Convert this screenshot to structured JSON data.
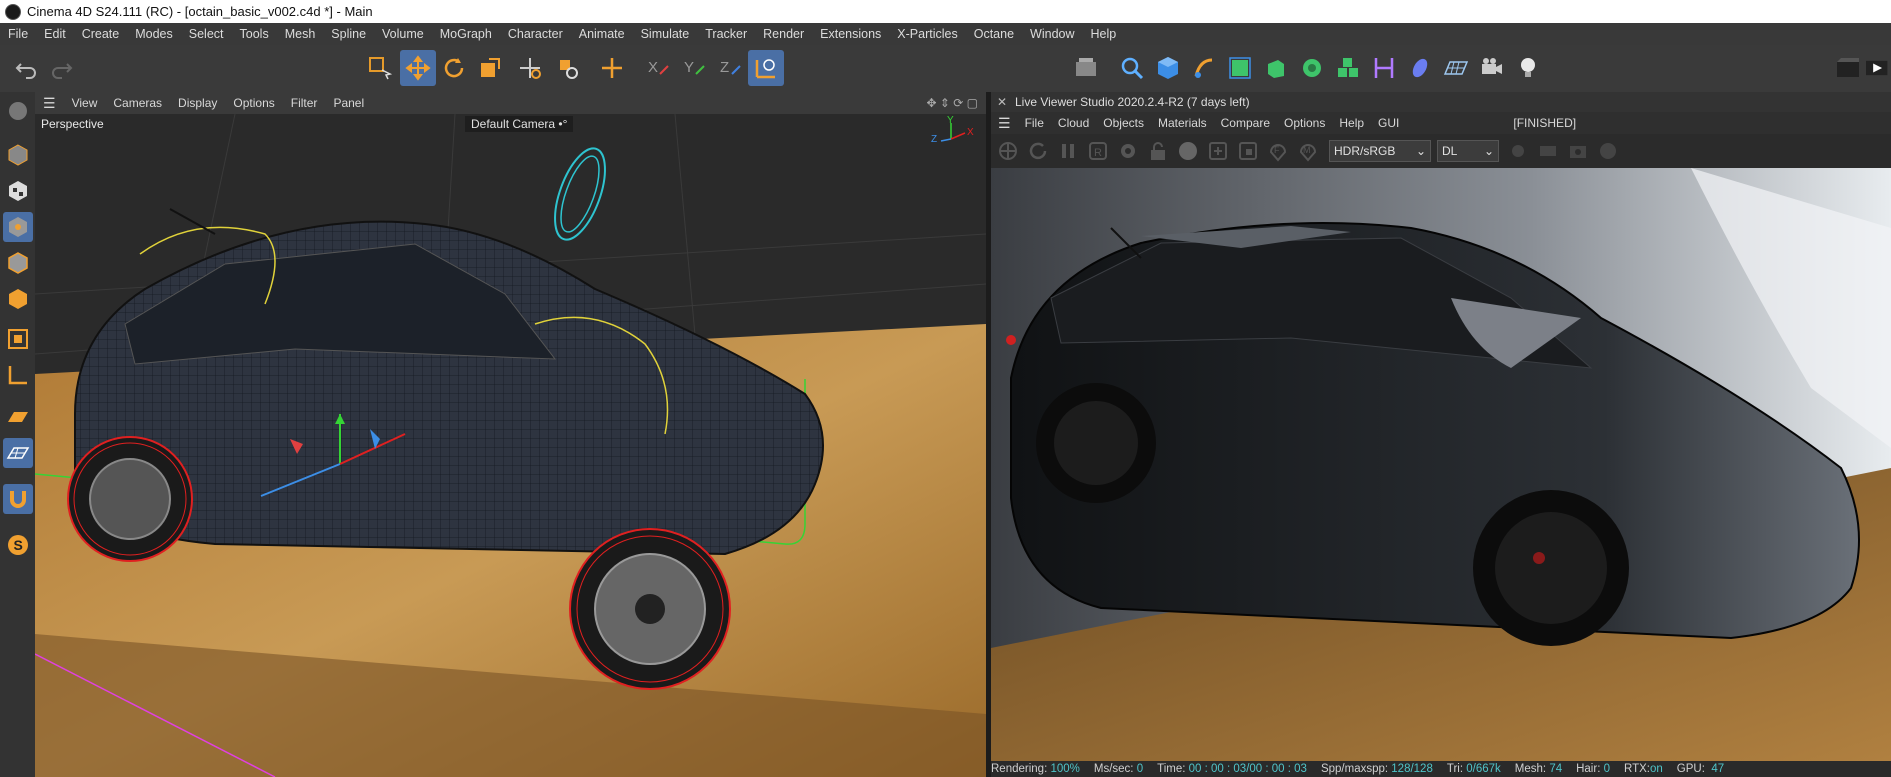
{
  "window": {
    "title": "Cinema 4D S24.111 (RC) - [octain_basic_v002.c4d *] - Main"
  },
  "menu": [
    "File",
    "Edit",
    "Create",
    "Modes",
    "Select",
    "Tools",
    "Mesh",
    "Spline",
    "Volume",
    "MoGraph",
    "Character",
    "Animate",
    "Simulate",
    "Tracker",
    "Render",
    "Extensions",
    "X-Particles",
    "Octane",
    "Window",
    "Help"
  ],
  "toolbar_icons": [
    "undo-icon",
    "redo-icon",
    "live-selection-icon",
    "move-icon",
    "rotate-icon",
    "scale-icon",
    "transform-icon",
    "place-icon",
    "axis-icon",
    "lock-x-icon",
    "lock-y-icon",
    "lock-z-icon",
    "coordinate-system-icon",
    "render-region-icon",
    "spline-pen-icon",
    "cube-icon",
    "paint-icon",
    "subdivision-icon",
    "extrude-icon",
    "mograph-icon",
    "cloner-icon",
    "symmetry-icon",
    "field-icon",
    "floor-icon",
    "camera-icon",
    "light-icon",
    "render-settings-icon"
  ],
  "viewport": {
    "menu": [
      "View",
      "Cameras",
      "Display",
      "Options",
      "Filter",
      "Panel"
    ],
    "label": "Perspective",
    "camera": "Default Camera",
    "camera_suffix": "•°",
    "axis": {
      "x": "X",
      "y": "Y",
      "z": "Z"
    }
  },
  "live_viewer": {
    "title": "Live Viewer Studio 2020.2.4-R2 (7 days left)",
    "menu": [
      "File",
      "Cloud",
      "Objects",
      "Materials",
      "Compare",
      "Options",
      "Help",
      "GUI"
    ],
    "status": "[FINISHED]",
    "color_space": "HDR/sRGB",
    "kernel": "DL"
  },
  "status": {
    "rendering_label": "Rendering:",
    "rendering": "100%",
    "ms_label": "Ms/sec:",
    "ms": "0",
    "time_label": "Time:",
    "time": "00 : 00 : 03/00 : 00 : 03",
    "spp_label": "Spp/maxspp:",
    "spp": "128/128",
    "tri_label": "Tri:",
    "tri": "0/667k",
    "mesh_label": "Mesh:",
    "mesh": "74",
    "hair_label": "Hair:",
    "hair": "0",
    "rtx_label": "RTX:",
    "rtx": "on",
    "gpu_label": "GPU:",
    "gpu": "47"
  },
  "colors": {
    "accent": "#4a6fa5",
    "status_value": "#4fc3c8",
    "spline": "#e0d23a",
    "selection": "#e02020",
    "bbox": "#35d435"
  }
}
